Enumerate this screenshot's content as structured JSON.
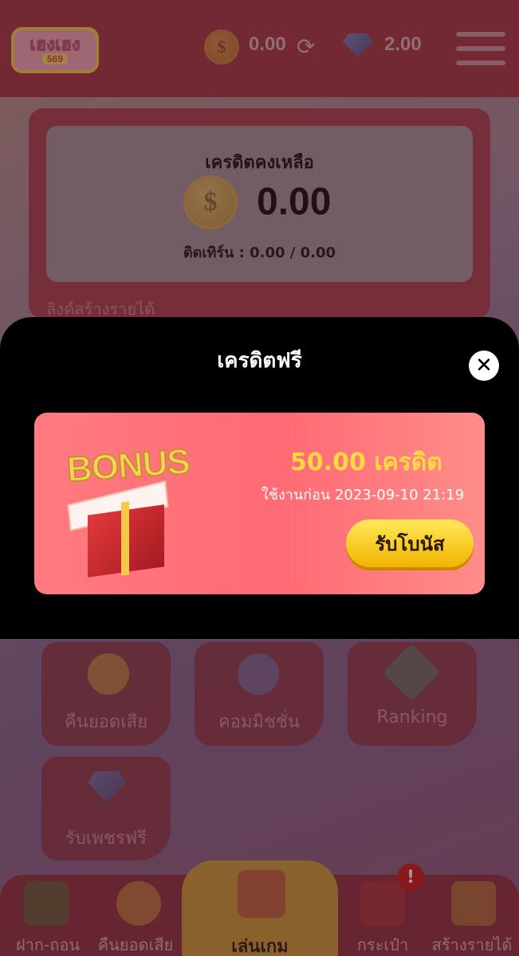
{
  "header": {
    "logo_line1": "เฮงเฮง",
    "logo_line2": "569",
    "coin_balance": "0.00",
    "gem_balance": "2.00"
  },
  "balance_card": {
    "title": "เครดิตคงเหลือ",
    "amount": "0.00",
    "turnover_label": "ติดเทิร์น : 0.00 / 0.00",
    "link_label": "ลิงค์สร้างรายได้"
  },
  "modal": {
    "title": "เครดิตฟรี",
    "bonus_word": "BONUS",
    "bonus_amount": "50.00 เครดิต",
    "bonus_expire": "ใช้งานก่อน 2023-09-10 21:19",
    "claim_label": "รับโบนัส"
  },
  "tiles": [
    {
      "label": "คืนยอดเสีย",
      "icon": "coin-hand-icon"
    },
    {
      "label": "คอมมิชชั่น",
      "icon": "clock-coin-hand-icon"
    },
    {
      "label": "Ranking",
      "icon": "ranking-emblem-icon"
    },
    {
      "label": "รับเพชรฟรี",
      "icon": "diamond-icon"
    }
  ],
  "bottom_nav": {
    "items": [
      {
        "label": "ฝาก-ถอน",
        "icon": "money-stack-icon"
      },
      {
        "label": "คืนยอดเสีย",
        "icon": "coin-hand-icon"
      },
      {
        "label": "เล่นเกม",
        "icon": "slot-machine-icon"
      },
      {
        "label": "กระเป๋า",
        "icon": "backpack-icon"
      },
      {
        "label": "สร้างรายได้",
        "icon": "people-icon"
      }
    ],
    "badge": "!"
  },
  "colors": {
    "header": "#a03b45",
    "modal": "#000000",
    "bonus_card": "#ff6a73",
    "bonus_amount": "#ffd940",
    "claim_button": "#f7c91c"
  }
}
